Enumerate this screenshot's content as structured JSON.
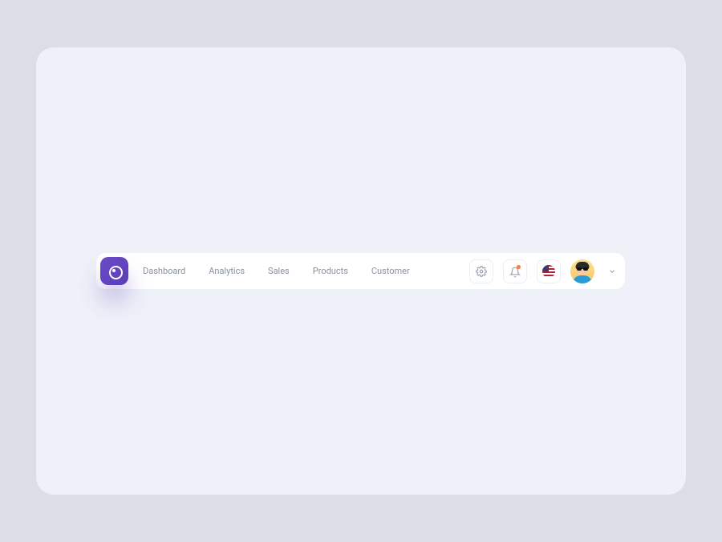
{
  "nav": {
    "items": [
      {
        "label": "Dashboard"
      },
      {
        "label": "Analytics"
      },
      {
        "label": "Sales"
      },
      {
        "label": "Products"
      },
      {
        "label": "Customer"
      }
    ]
  },
  "icons": {
    "logo": "speech-ring-icon",
    "settings": "gear-icon",
    "notifications": "bell-icon",
    "language_flag": "us-flag-icon",
    "user_menu_chevron": "chevron-down-icon"
  },
  "notifications": {
    "has_unread": true
  },
  "colors": {
    "accent": "#5b3db8",
    "notification_dot": "#ff7a3d",
    "nav_text": "#8a90a3",
    "page_bg": "#dcdee6",
    "canvas_bg": "#eef1f8"
  }
}
